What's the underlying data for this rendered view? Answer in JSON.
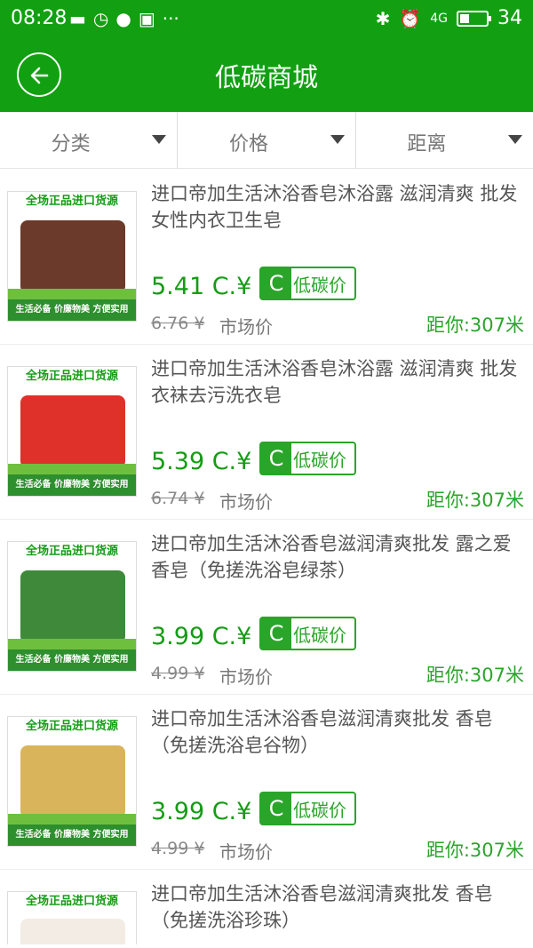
{
  "status_bar": {
    "time": "08:28",
    "battery": "34",
    "network": "4G"
  },
  "header": {
    "title": "低碳商城"
  },
  "filters": [
    {
      "label": "分类"
    },
    {
      "label": "价格"
    },
    {
      "label": "距离"
    }
  ],
  "items": [
    {
      "name": "进口帝加生活沐浴香皂沐浴露 滋润清爽 批发 女性内衣卫生皂",
      "price": "5.41 C.¥",
      "badge_c": "C",
      "badge_text": "低碳价",
      "original_price": "6.76 ¥",
      "market_label": "市场价",
      "distance": "距你:307米",
      "thumb_top": "全场正品进口货源",
      "thumb_bottom": "生活必备 价廉物美 方便实用",
      "product_color": "#6b3a2b"
    },
    {
      "name": "进口帝加生活沐浴香皂沐浴露 滋润清爽 批发 衣袜去污洗衣皂",
      "price": "5.39 C.¥",
      "badge_c": "C",
      "badge_text": "低碳价",
      "original_price": "6.74 ¥",
      "market_label": "市场价",
      "distance": "距你:307米",
      "thumb_top": "全场正品进口货源",
      "thumb_bottom": "生活必备 价廉物美 方便实用",
      "product_color": "#e0302a"
    },
    {
      "name": "进口帝加生活沐浴香皂滋润清爽批发 露之爱香皂（免搓洗浴皂绿茶）",
      "price": "3.99 C.¥",
      "badge_c": "C",
      "badge_text": "低碳价",
      "original_price": "4.99 ¥",
      "market_label": "市场价",
      "distance": "距你:307米",
      "thumb_top": "全场正品进口货源",
      "thumb_bottom": "生活必备 价廉物美 方便实用",
      "product_color": "#3f8a3a"
    },
    {
      "name": "进口帝加生活沐浴香皂滋润清爽批发 香皂（免搓洗浴皂谷物）",
      "price": "3.99 C.¥",
      "badge_c": "C",
      "badge_text": "低碳价",
      "original_price": "4.99 ¥",
      "market_label": "市场价",
      "distance": "距你:307米",
      "thumb_top": "全场正品进口货源",
      "thumb_bottom": "生活必备 价廉物美 方便实用",
      "product_color": "#d9b45a"
    },
    {
      "name": "进口帝加生活沐浴香皂滋润清爽批发 香皂（免搓洗浴珍珠）",
      "price": "",
      "badge_c": "",
      "badge_text": "",
      "original_price": "",
      "market_label": "",
      "distance": "",
      "thumb_top": "全场正品进口货源",
      "thumb_bottom": "",
      "product_color": "#f2ece4"
    }
  ]
}
